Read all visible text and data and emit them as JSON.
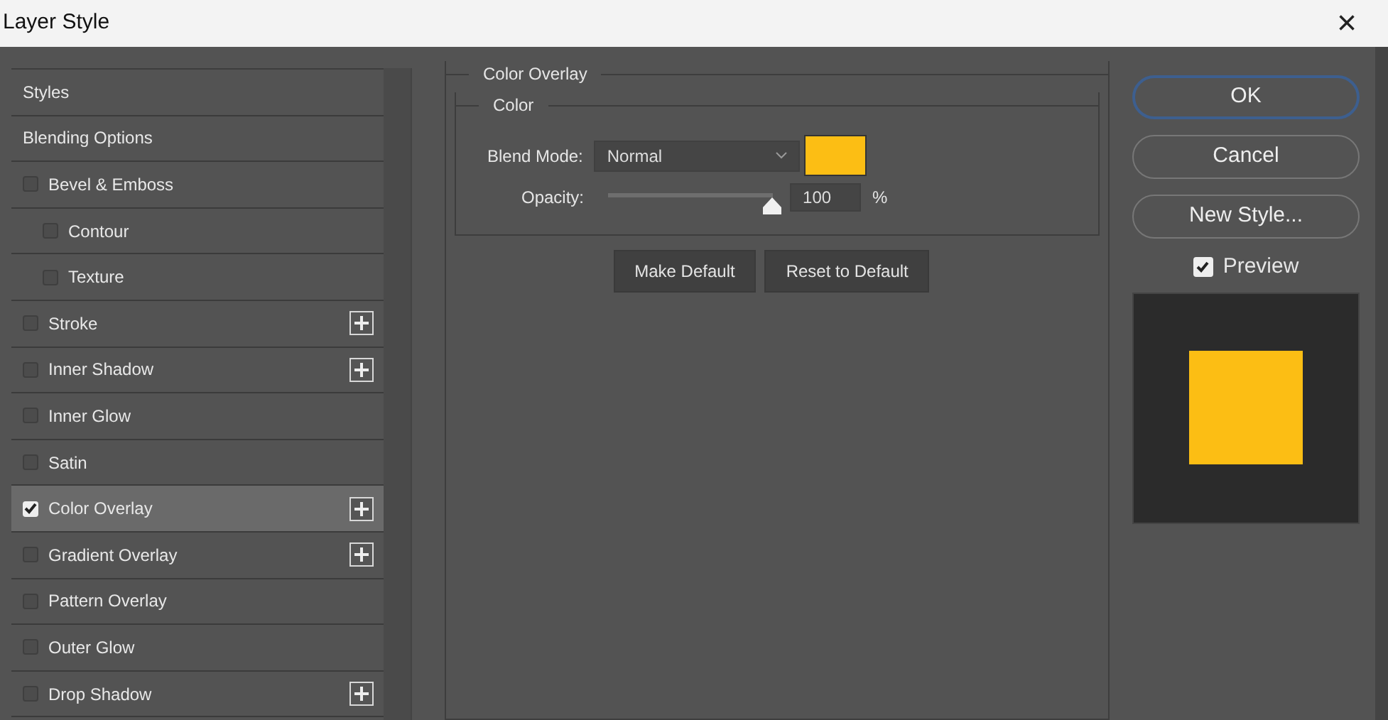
{
  "window": {
    "title": "Layer Style",
    "close": "×"
  },
  "styles_list": [
    {
      "kind": "plain",
      "label": "Styles",
      "selected": false
    },
    {
      "kind": "plain",
      "label": "Blending Options",
      "selected": false
    },
    {
      "kind": "checkbox",
      "label": "Bevel & Emboss",
      "checked": false,
      "selected": false,
      "add": false,
      "children": [
        {
          "kind": "checkbox",
          "label": "Contour",
          "checked": false,
          "selected": false,
          "add": false
        },
        {
          "kind": "checkbox",
          "label": "Texture",
          "checked": false,
          "selected": false,
          "add": false
        }
      ]
    },
    {
      "kind": "checkbox",
      "label": "Stroke",
      "checked": false,
      "selected": false,
      "add": true
    },
    {
      "kind": "checkbox",
      "label": "Inner Shadow",
      "checked": false,
      "selected": false,
      "add": true
    },
    {
      "kind": "checkbox",
      "label": "Inner Glow",
      "checked": false,
      "selected": false,
      "add": false
    },
    {
      "kind": "checkbox",
      "label": "Satin",
      "checked": false,
      "selected": false,
      "add": false
    },
    {
      "kind": "checkbox",
      "label": "Color Overlay",
      "checked": true,
      "selected": true,
      "add": true
    },
    {
      "kind": "checkbox",
      "label": "Gradient Overlay",
      "checked": false,
      "selected": false,
      "add": true
    },
    {
      "kind": "checkbox",
      "label": "Pattern Overlay",
      "checked": false,
      "selected": false,
      "add": false
    },
    {
      "kind": "checkbox",
      "label": "Outer Glow",
      "checked": false,
      "selected": false,
      "add": false
    },
    {
      "kind": "checkbox",
      "label": "Drop Shadow",
      "checked": false,
      "selected": false,
      "add": true
    }
  ],
  "panel": {
    "title": "Color Overlay",
    "group_title": "Color",
    "blend_mode": {
      "label": "Blend Mode:",
      "value": "Normal"
    },
    "color": "#fcbe14",
    "opacity": {
      "label": "Opacity:",
      "level": 1.0,
      "value": "100",
      "unit": "%"
    },
    "buttons": [
      "Make Default",
      "Reset to Default"
    ]
  },
  "actions": [
    {
      "label": "OK",
      "default": true
    },
    {
      "label": "Cancel",
      "default": false
    },
    {
      "label": "New Style...",
      "default": false
    }
  ],
  "preview": {
    "label": "Preview",
    "checked": true
  }
}
